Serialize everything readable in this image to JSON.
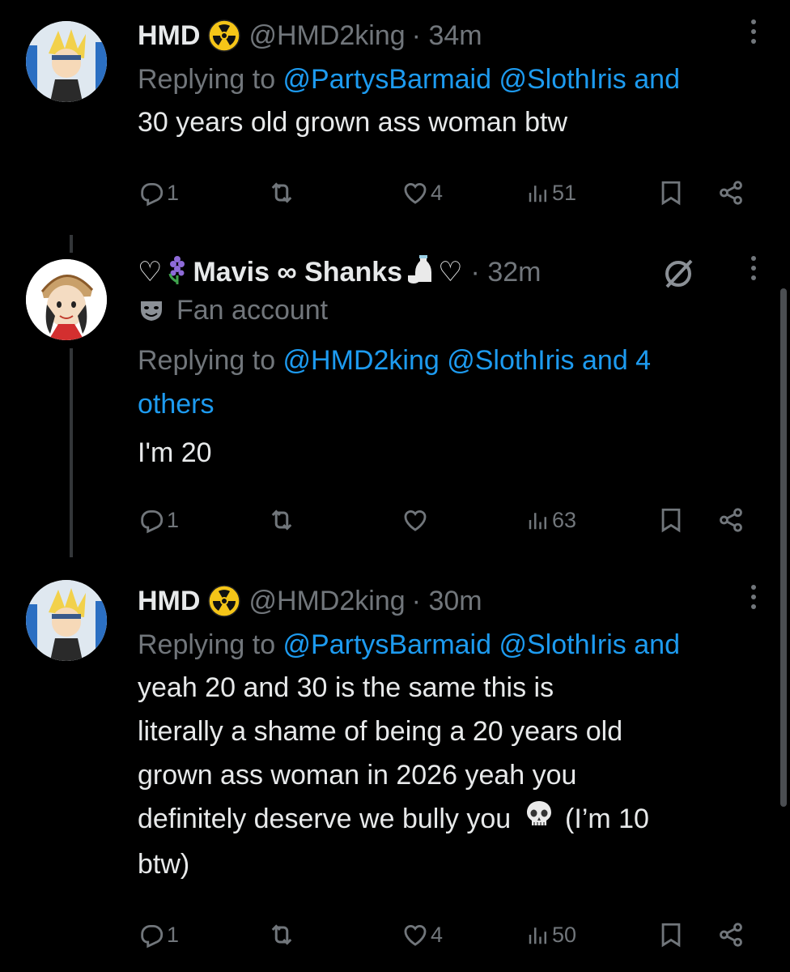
{
  "tweets": [
    {
      "name": "HMD",
      "badge_icon": "radioactive-icon",
      "handle": "@HMD2king",
      "time": "· 34m",
      "replying_prefix": "Replying to ",
      "replying_links": "@PartysBarmaid @SlothIris and",
      "text": "30 years old grown ass woman btw",
      "replies": "1",
      "retweets": "",
      "likes": "4",
      "views": "51"
    },
    {
      "name_prefix": "♡",
      "name": "Mavis ∞ Shanks",
      "name_suffix": "♡",
      "time": "· 32m",
      "label": "Fan account",
      "replying_prefix": "Replying to ",
      "replying_links_line1": "@HMD2king @SlothIris and 4",
      "replying_links_line2": "others",
      "text": "I'm 20",
      "replies": "1",
      "retweets": "",
      "likes": "",
      "views": "63"
    },
    {
      "name": "HMD",
      "badge_icon": "radioactive-icon",
      "handle": "@HMD2king",
      "time": "· 30m",
      "replying_prefix": "Replying to ",
      "replying_links": "@PartysBarmaid @SlothIris and",
      "text_lines": [
        "yeah 20 and 30 is the same this is",
        "literally a shame of being a 20 years old",
        "grown ass woman in 2026 yeah you",
        "definitely deserve we bully you",
        "btw)"
      ],
      "text_tail": " (I’m 10",
      "replies": "1",
      "retweets": "",
      "likes": "4",
      "views": "50"
    }
  ],
  "colors": {
    "background": "#000000",
    "text": "#e7e9ea",
    "muted": "#71767b",
    "link": "#1d9bf0",
    "badge": "#f5c518"
  }
}
